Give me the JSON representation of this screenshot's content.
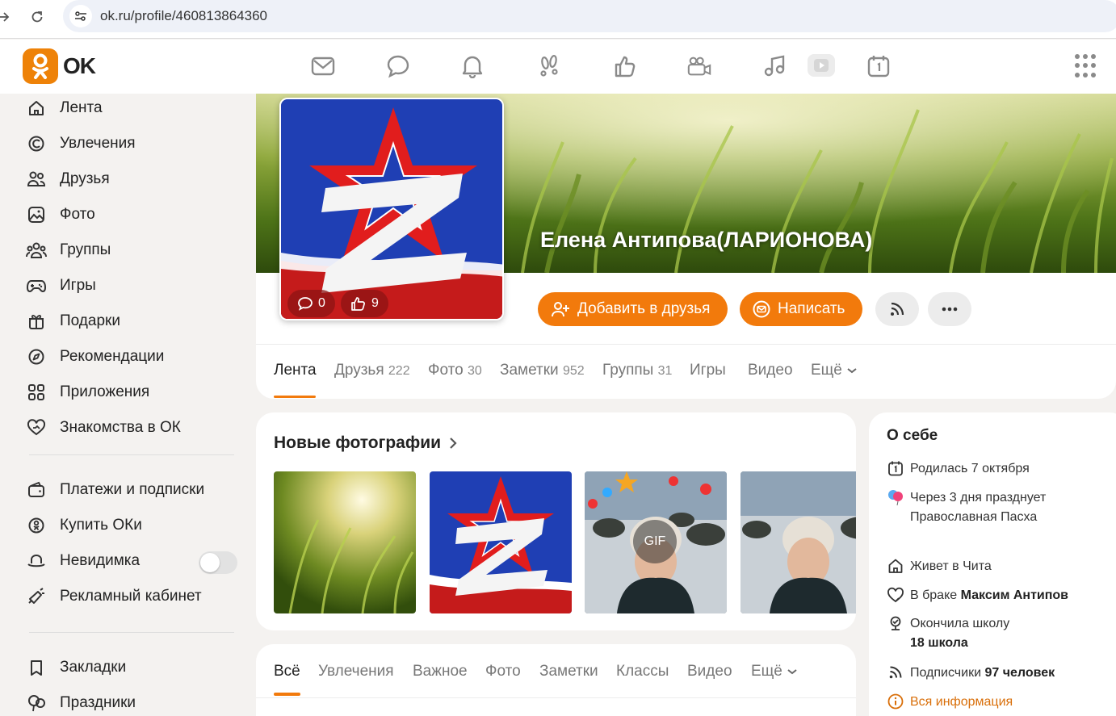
{
  "browser": {
    "url": "ok.ru/profile/460813864360"
  },
  "header": {
    "logo_text": "OK",
    "icons": [
      "mail-icon",
      "chat-icon",
      "bell-icon",
      "footprints-icon",
      "thumb-up-icon",
      "camera-icon",
      "music-icon",
      "video-icon",
      "calendar-icon",
      "apps-grid-icon"
    ]
  },
  "sidebar": {
    "items": [
      {
        "label": "Лента",
        "icon": "home-icon"
      },
      {
        "label": "Увлечения",
        "icon": "hobby-icon"
      },
      {
        "label": "Друзья",
        "icon": "friends-icon"
      },
      {
        "label": "Фото",
        "icon": "photo-icon"
      },
      {
        "label": "Группы",
        "icon": "groups-icon"
      },
      {
        "label": "Игры",
        "icon": "gamepad-icon"
      },
      {
        "label": "Подарки",
        "icon": "gift-icon"
      },
      {
        "label": "Рекомендации",
        "icon": "compass-icon"
      },
      {
        "label": "Приложения",
        "icon": "apps-icon"
      },
      {
        "label": "Знакомства в ОК",
        "icon": "dating-heart-icon"
      }
    ],
    "items2": [
      {
        "label": "Платежи и подписки",
        "icon": "wallet-icon"
      },
      {
        "label": "Купить ОКи",
        "icon": "coin-icon"
      },
      {
        "label": "Невидимка",
        "icon": "invisible-hat-icon"
      },
      {
        "label": "Рекламный кабинет",
        "icon": "megaphone-icon"
      }
    ],
    "items3": [
      {
        "label": "Закладки",
        "icon": "bookmark-icon"
      },
      {
        "label": "Праздники",
        "icon": "balloon-icon"
      }
    ]
  },
  "profile": {
    "name": "Елена Антипова(ЛАРИОНОВА)",
    "avatar_comments": "0",
    "avatar_likes": "9",
    "add_friend_label": "Добавить в друзья",
    "write_label": "Написать",
    "tabs": [
      {
        "label": "Лента",
        "count": ""
      },
      {
        "label": "Друзья",
        "count": "222"
      },
      {
        "label": "Фото",
        "count": "30"
      },
      {
        "label": "Заметки",
        "count": "952"
      },
      {
        "label": "Группы",
        "count": "31"
      },
      {
        "label": "Игры",
        "count": ""
      },
      {
        "label": "Видео",
        "count": ""
      },
      {
        "label": "Ещё",
        "count": ""
      }
    ]
  },
  "photos": {
    "title": "Новые фотографии",
    "gif_label": "GIF"
  },
  "feed": {
    "tabs": [
      "Всё",
      "Увлечения",
      "Важное",
      "Фото",
      "Заметки",
      "Классы",
      "Видео",
      "Ещё"
    ]
  },
  "about": {
    "title": "О себе",
    "birthday": "Родилась 7 октября",
    "holiday": "Через 3 дня празднует Православная Пасха",
    "lives": "Живет в Чита",
    "married_prefix": "В браке",
    "married_name": "Максим Антипов",
    "school_prefix": "Окончила школу",
    "school_name": "18 школа",
    "subscribers_prefix": "Подписчики",
    "subscribers_count": "97 человек",
    "all_info": "Вся информация"
  },
  "colors": {
    "accent": "#f27a0c",
    "logo": "#ee8208"
  }
}
